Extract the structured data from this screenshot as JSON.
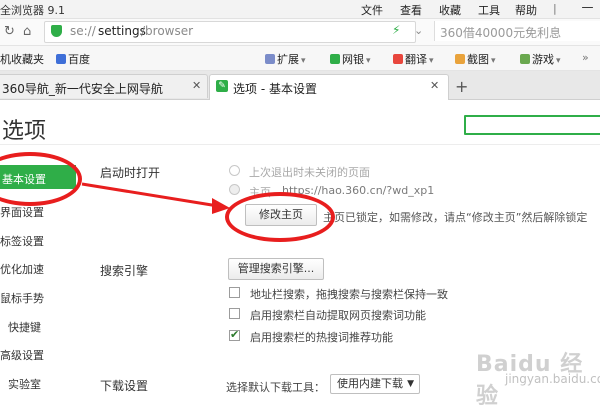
{
  "window": {
    "title": "全浏览器 9.1",
    "menu": [
      "文件",
      "查看",
      "收藏",
      "工具",
      "帮助"
    ]
  },
  "address_bar": {
    "url_prefix": "se://",
    "url_path": "settings",
    "url_rest": "/browser",
    "search_placeholder": "360借40000元免利息"
  },
  "bookmarks": {
    "items": [
      {
        "label": "机收藏夹",
        "icon": "star-icon"
      },
      {
        "label": "百度",
        "icon": "baidu-icon"
      },
      {
        "label": "扩展",
        "icon": "extension-icon",
        "dropdown": true
      },
      {
        "label": "网银",
        "icon": "shield-icon",
        "dropdown": true
      },
      {
        "label": "翻译",
        "icon": "translate-icon",
        "dropdown": true
      },
      {
        "label": "截图",
        "icon": "scissors-icon",
        "dropdown": true
      },
      {
        "label": "游戏",
        "icon": "gamepad-icon",
        "dropdown": true
      }
    ]
  },
  "tabs": [
    {
      "label": "360导航_新一代安全上网导航",
      "active": false
    },
    {
      "label": "选项 - 基本设置",
      "active": true
    }
  ],
  "page": {
    "title": "选项"
  },
  "sidebar": {
    "items": [
      {
        "label": "基本设置",
        "active": true
      },
      {
        "label": "界面设置"
      },
      {
        "label": "标签设置"
      },
      {
        "label": "优化加速"
      },
      {
        "label": "鼠标手势"
      },
      {
        "label": "快捷键"
      },
      {
        "label": "高级设置"
      },
      {
        "label": "实验室"
      }
    ]
  },
  "startup": {
    "heading": "启动时打开",
    "option_last_session": "上次退出时未关闭的页面",
    "option_home_label": "主页",
    "home_url": "https://hao.360.cn/?wd_xp1",
    "modify_button": "修改主页",
    "locked_note": "主页已锁定，如需修改，请点“修改主页”然后解除锁定"
  },
  "search_engine": {
    "heading": "搜索引擎",
    "manage_button": "管理搜索引擎...",
    "options": [
      {
        "label": "地址栏搜索，拖拽搜索与搜索栏保持一致",
        "checked": false
      },
      {
        "label": "启用搜索栏自动提取网页搜索词功能",
        "checked": false
      },
      {
        "label": "启用搜索栏的热搜词推荐功能",
        "checked": true
      }
    ]
  },
  "download": {
    "heading": "下载设置",
    "select_label": "选择默认下载工具：",
    "selected_tool": "使用内建下载"
  },
  "watermark": {
    "logo": "Baidu 经验",
    "sub": "jingyan.baidu.com"
  },
  "colors": {
    "accent": "#2fae48",
    "annotation": "#e81e1e"
  }
}
